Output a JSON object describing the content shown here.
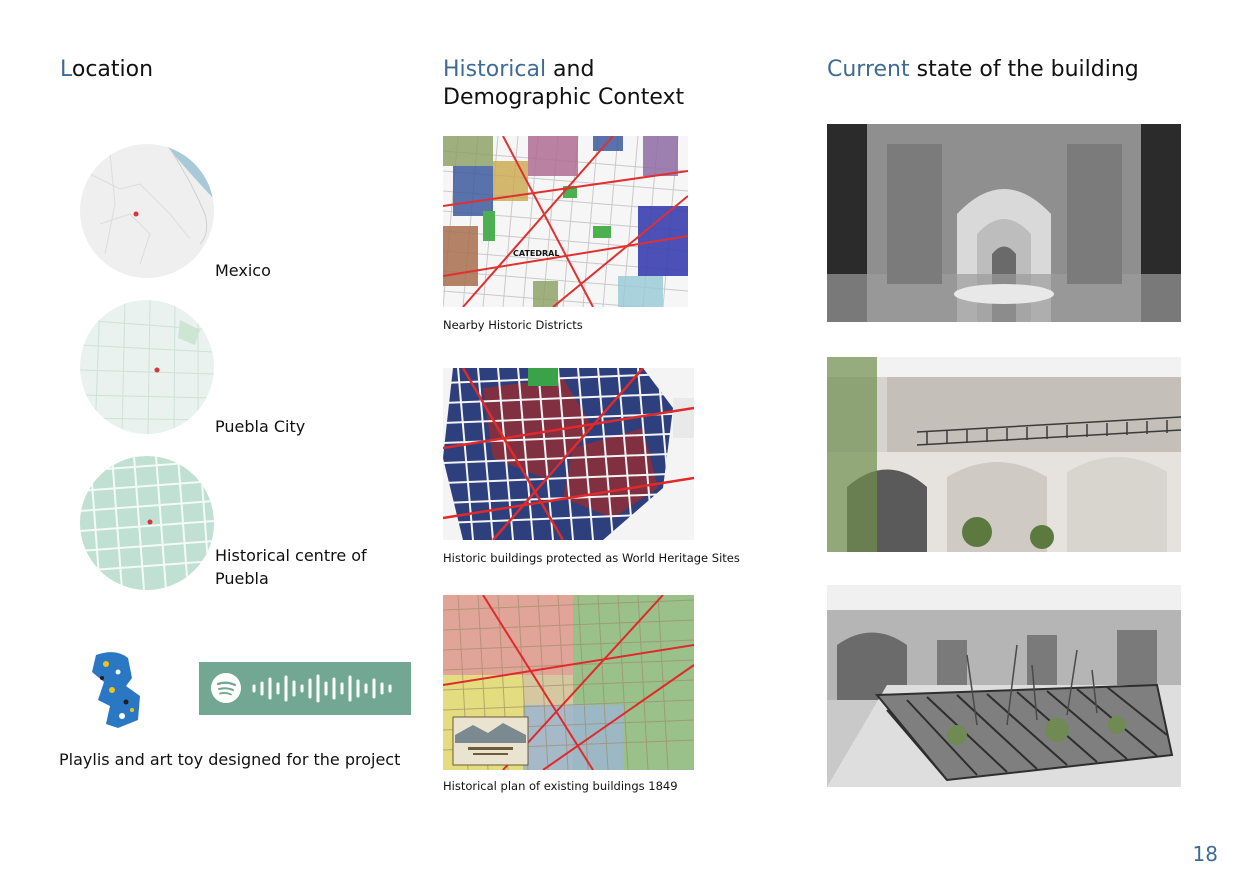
{
  "location": {
    "heading_accent": "L",
    "heading_rest": "ocation",
    "maps": [
      {
        "label": "Mexico"
      },
      {
        "label": "Puebla City"
      },
      {
        "label_line1": "Historical centre of",
        "label_line2": "Puebla"
      }
    ],
    "footer_text": "Playlis and art toy designed for the project"
  },
  "historical": {
    "heading_accent": "Historical",
    "heading_rest": " and",
    "heading_line2": "Demographic Context",
    "maps": [
      {
        "caption": "Nearby Historic Districts",
        "inner_label": "CATEDRAL"
      },
      {
        "caption": "Historic buildings protected as World Heritage Sites"
      },
      {
        "caption": "Historical plan of existing buildings 1849"
      }
    ]
  },
  "current": {
    "heading_accent": "Current",
    "heading_rest": " state of the building"
  },
  "colors": {
    "accent": "#3e6b96",
    "spotify_green": "#72a893"
  },
  "page_number": "18"
}
